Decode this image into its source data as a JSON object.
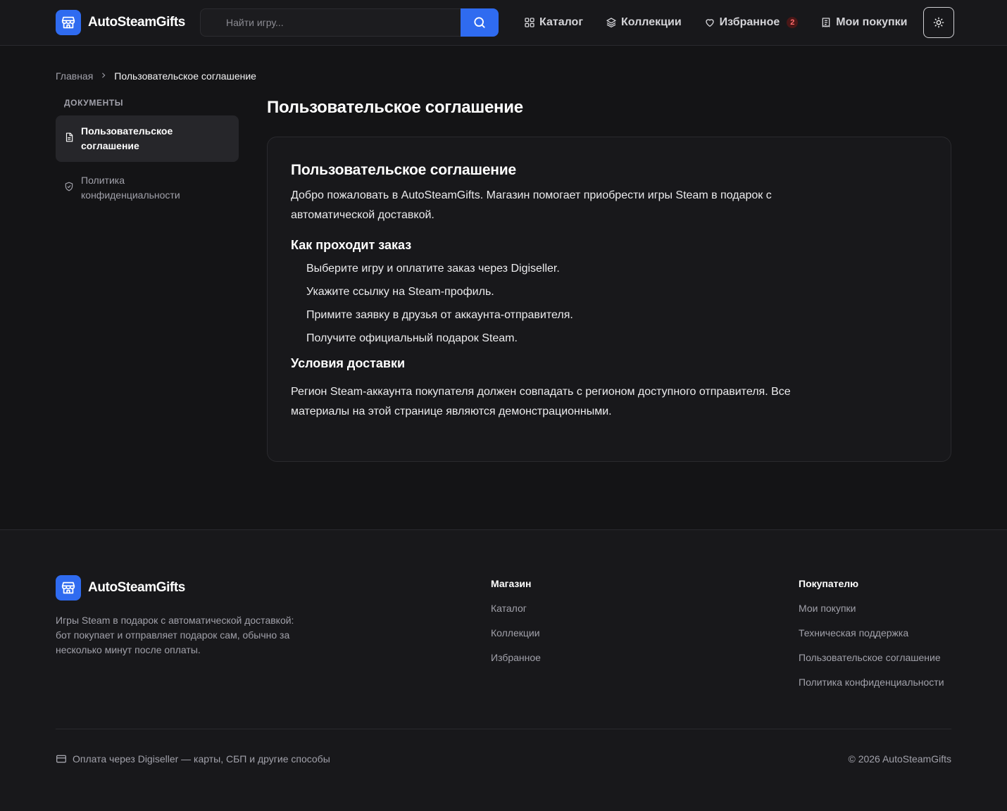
{
  "brand": {
    "name": "AutoSteamGifts",
    "accent_color": "#2f6bf0",
    "logo_icon": "store-icon"
  },
  "header": {
    "search": {
      "placeholder": "Найти игру...",
      "value": "",
      "button_icon": "search-icon"
    },
    "nav": [
      {
        "label": "Каталог",
        "icon": "grid-icon"
      },
      {
        "label": "Коллекции",
        "icon": "layers-icon"
      },
      {
        "label": "Избранное",
        "icon": "heart-icon",
        "badge": "2"
      },
      {
        "label": "Мои покупки",
        "icon": "receipt-icon"
      }
    ],
    "theme_toggle_icon": "sun-icon"
  },
  "breadcrumb": {
    "home": "Главная",
    "current": "Пользовательское соглашение"
  },
  "sidebar": {
    "heading": "ДОКУМЕНТЫ",
    "items": [
      {
        "label": "Пользовательское соглашение",
        "icon": "document-icon",
        "active": true
      },
      {
        "label": "Политика конфиденциальности",
        "icon": "shield-check-icon",
        "active": false
      }
    ]
  },
  "main": {
    "page_title": "Пользовательское соглашение",
    "card": {
      "title": "Пользовательское соглашение",
      "intro": "Добро пожаловать в AutoSteamGifts. Магазин помогает приобрести игры Steam в подарок с автоматической доставкой.",
      "order_heading": "Как проходит заказ",
      "order_steps": [
        "Выберите игру и оплатите заказ через Digiseller.",
        "Укажите ссылку на Steam-профиль.",
        "Примите заявку в друзья от аккаунта-отправителя.",
        "Получите официальный подарок Steam."
      ],
      "delivery_heading": "Условия доставки",
      "delivery_text": "Регион Steam-аккаунта покупателя должен совпадать с регионом доступного отправителя. Все материалы на этой странице являются демонстрационными."
    }
  },
  "footer": {
    "description": "Игры Steam в подарок с автоматической доставкой: бот покупает и отправляет подарок сам, обычно за несколько минут после оплаты.",
    "shop": {
      "title": "Магазин",
      "links": [
        "Каталог",
        "Коллекции",
        "Избранное"
      ]
    },
    "buyer": {
      "title": "Покупателю",
      "links": [
        "Мои покупки",
        "Техническая поддержка",
        "Пользовательское соглашение",
        "Политика конфиденциальности"
      ]
    },
    "payment": {
      "text": "Оплата через Digiseller — карты, СБП и другие способы",
      "icon": "credit-card-icon"
    },
    "copyright": "© 2026 AutoSteamGifts"
  }
}
